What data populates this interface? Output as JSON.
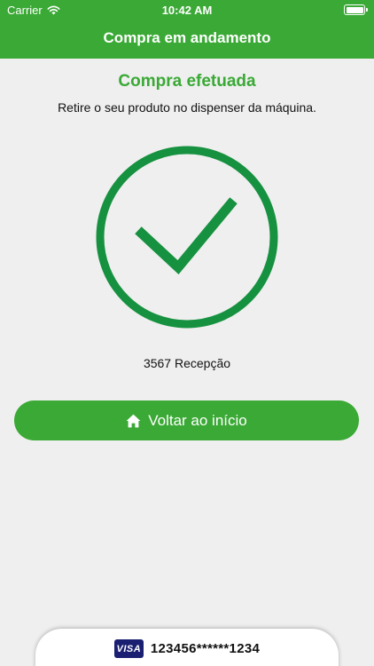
{
  "status_bar": {
    "carrier": "Carrier",
    "time": "10:42 AM",
    "icons": [
      "wifi-icon",
      "battery-icon"
    ]
  },
  "nav": {
    "title": "Compra em andamento"
  },
  "result": {
    "title": "Compra efetuada",
    "message": "Retire o seu produto no dispenser da máquina.",
    "icon": "checkmark-circle-icon"
  },
  "product": {
    "label": "3567 Recepção"
  },
  "actions": {
    "back_label": "Voltar ao início",
    "back_icon": "home-icon"
  },
  "payment": {
    "card_brand": "VISA",
    "card_number": "123456******1234"
  },
  "colors": {
    "brand_green": "#3aa935",
    "success_green": "#16913f",
    "background": "#efefef",
    "visa_blue": "#1a1f71"
  }
}
